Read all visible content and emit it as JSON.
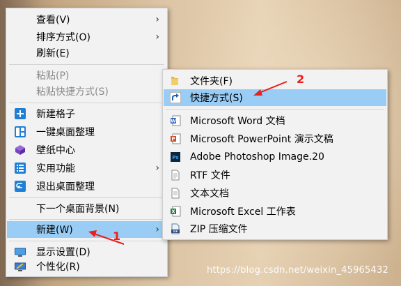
{
  "main_menu": {
    "items": [
      {
        "label": "查看(V)"
      },
      {
        "label": "排序方式(O)"
      },
      {
        "label": "刷新(E)"
      },
      {
        "label": "粘贴(P)"
      },
      {
        "label": "粘贴快捷方式(S)"
      },
      {
        "label": "新建格子"
      },
      {
        "label": "一键桌面整理"
      },
      {
        "label": "壁纸中心"
      },
      {
        "label": "实用功能"
      },
      {
        "label": "退出桌面整理"
      },
      {
        "label": "下一个桌面背景(N)"
      },
      {
        "label": "新建(W)"
      },
      {
        "label": "显示设置(D)"
      },
      {
        "label": "个性化(R)"
      }
    ]
  },
  "sub_menu": {
    "items": [
      {
        "label": "文件夹(F)"
      },
      {
        "label": "快捷方式(S)"
      },
      {
        "label": "Microsoft Word 文档"
      },
      {
        "label": "Microsoft PowerPoint 演示文稿"
      },
      {
        "label": "Adobe Photoshop Image.20"
      },
      {
        "label": "RTF 文件"
      },
      {
        "label": "文本文档"
      },
      {
        "label": "Microsoft Excel 工作表"
      },
      {
        "label": "ZIP 压缩文件"
      }
    ]
  },
  "annotations": {
    "step1": "1",
    "step2": "2"
  },
  "watermark": "https://blog.csdn.net/weixin_45965432",
  "colors": {
    "highlight": "#99cdf5",
    "menu_bg": "#f2f2f2",
    "annotation": "#e8201c"
  }
}
